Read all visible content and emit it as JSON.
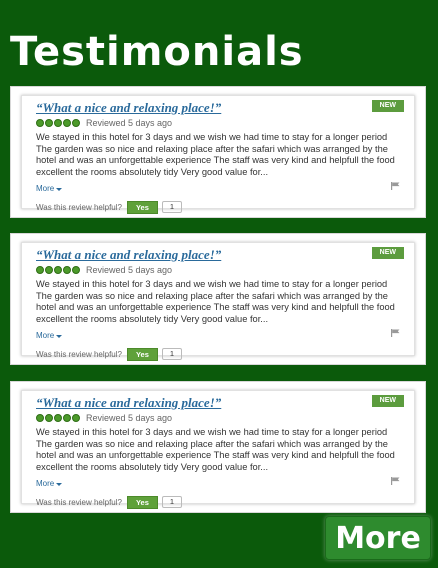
{
  "page": {
    "title": "Testimonials",
    "more_button": "More"
  },
  "colors": {
    "background": "#0b5a0b",
    "accent_green": "#5c9c3e",
    "link_blue": "#2a6a9b"
  },
  "reviews": [
    {
      "title": "“What a nice and relaxing place!”",
      "badge": "NEW",
      "rating": 5,
      "reviewed": "Reviewed 5 days ago",
      "text": "We stayed in this hotel for 3 days and we wish we had time to stay for a longer period The garden was so nice and relaxing place after the safari which was arranged by the hotel and was an unforgettable experience The staff was very kind and helpfull the food excellent the rooms absolutely tidy Very good value for...",
      "more": "More",
      "helpful_label": "Was this review helpful?",
      "yes": "Yes",
      "count": "1"
    },
    {
      "title": "“What a nice and relaxing place!”",
      "badge": "NEW",
      "rating": 5,
      "reviewed": "Reviewed 5 days ago",
      "text": "We stayed in this hotel for 3 days and we wish we had time to stay for a longer period The garden was so nice and relaxing place after the safari which was arranged by the hotel and was an unforgettable experience The staff was very kind and helpfull the food excellent the rooms absolutely tidy Very good value for...",
      "more": "More",
      "helpful_label": "Was this review helpful?",
      "yes": "Yes",
      "count": "1"
    },
    {
      "title": "“What a nice and relaxing place!”",
      "badge": "NEW",
      "rating": 5,
      "reviewed": "Reviewed 5 days ago",
      "text": "We stayed in this hotel for 3 days and we wish we had time to stay for a longer period The garden was so nice and relaxing place after the safari which was arranged by the hotel and was an unforgettable experience The staff was very kind and helpfull the food excellent the rooms absolutely tidy Very good value for...",
      "more": "More",
      "helpful_label": "Was this review helpful?",
      "yes": "Yes",
      "count": "1"
    }
  ]
}
